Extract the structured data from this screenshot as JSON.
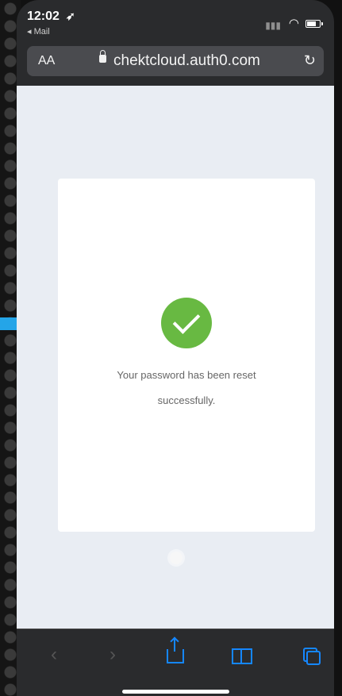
{
  "status_bar": {
    "time": "12:02",
    "back_app": "◂ Mail"
  },
  "browser": {
    "text_size_label": "AA",
    "url": "chektcloud.auth0.com"
  },
  "message": {
    "line1": "Your password has been reset",
    "line2": "successfully."
  },
  "icons": {
    "location": "location-arrow-icon",
    "signal": "cellular-signal-icon",
    "wifi": "wifi-icon",
    "battery": "battery-icon",
    "lock": "lock-icon",
    "reload": "reload-icon",
    "success": "check-icon",
    "loader": "loading-icon",
    "pointer": "annotation-arrow-icon",
    "back": "chevron-left-icon",
    "forward": "chevron-right-icon",
    "share": "share-icon",
    "bookmarks": "book-icon",
    "tabs": "tabs-icon"
  },
  "colors": {
    "success": "#68b942",
    "ios_blue": "#1587ff",
    "page_background": "#e9edf3",
    "annotation": "#24a5e8"
  }
}
